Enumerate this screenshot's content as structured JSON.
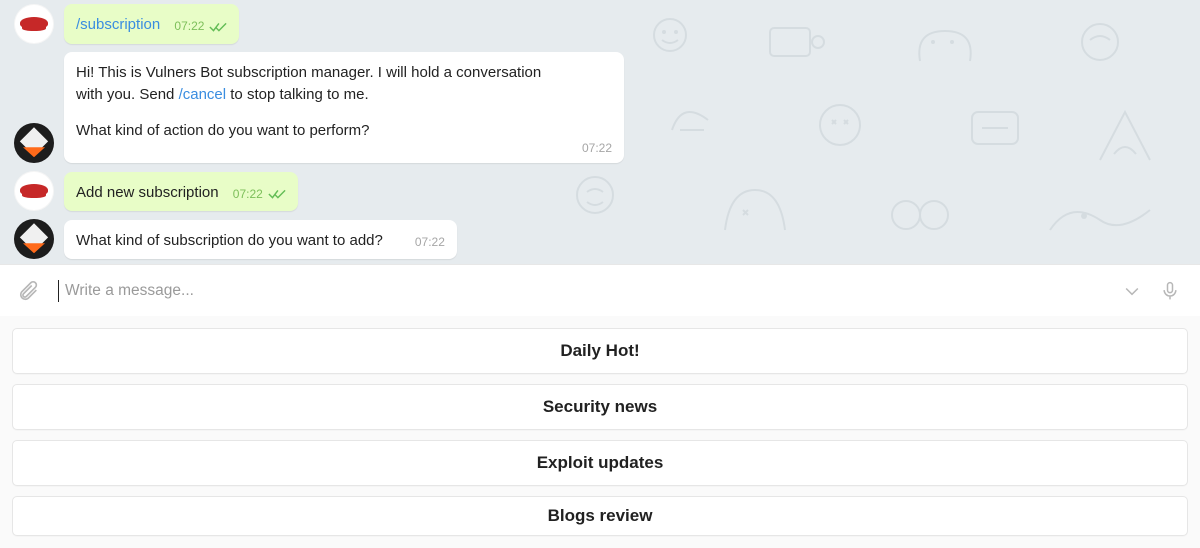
{
  "messages": {
    "out1": {
      "text": "/subscription",
      "time": "07:22"
    },
    "in1": {
      "line1_pre": "Hi! This is Vulners Bot subscription manager. I will hold a conversation with you. Send ",
      "line1_cmd": "/cancel",
      "line1_post": " to stop talking to me.",
      "line2": "What kind of action do you want to perform?",
      "time": "07:22"
    },
    "out2": {
      "text": "Add new subscription",
      "time": "07:22"
    },
    "in2": {
      "text": "What kind of subscription do you want to add?",
      "time": "07:22"
    }
  },
  "input": {
    "placeholder": "Write a message..."
  },
  "keyboard": {
    "b1": "Daily Hot!",
    "b2": "Security news",
    "b3": "Exploit updates",
    "b4": "Blogs review"
  }
}
